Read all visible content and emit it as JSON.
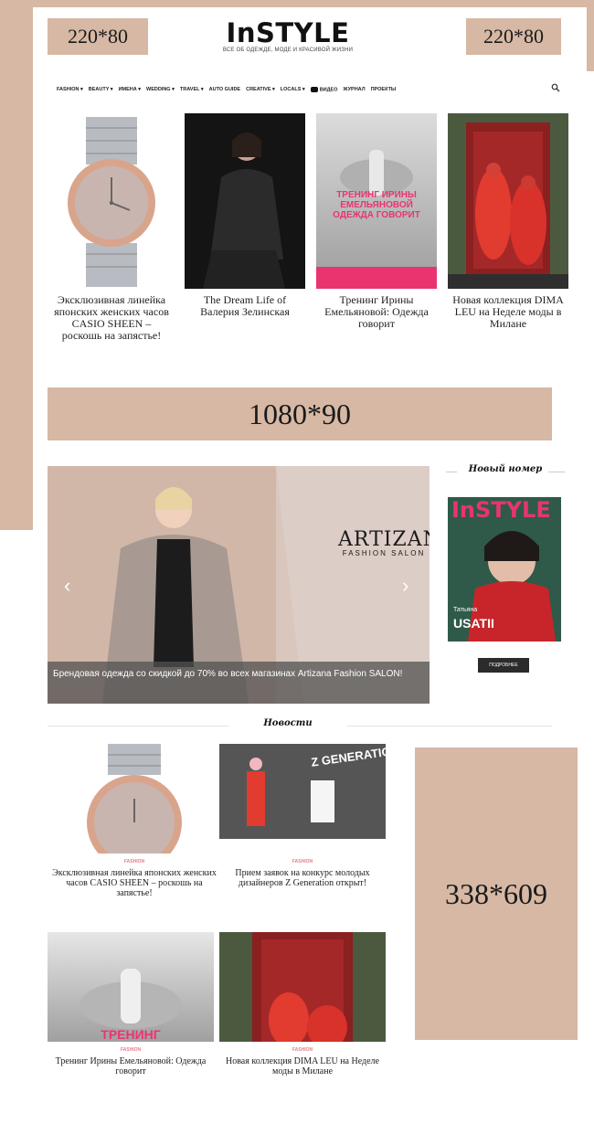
{
  "ads": {
    "left_header": "220*80",
    "right_header": "220*80",
    "middle_banner": "1080*90",
    "side": "338*609"
  },
  "logo": {
    "main": "InSTYLE",
    "tagline": "ВСЕ ОБ ОДЕЖДЕ, МОДЕ И КРАСИВОЙ ЖИЗНИ"
  },
  "nav": {
    "items": [
      "FASHION ▾",
      "BEAUTY ▾",
      "ИМЕНА ▾",
      "WEDDING ▾",
      "TRAVEL ▾",
      "AUTO GUIDE",
      "CREATIVE ▾",
      "LOCALS ▾",
      "ВИДЕО",
      "ЖУРНАЛ",
      "ПРОЕКТЫ"
    ]
  },
  "top_cards": [
    {
      "title": "Эксклюзивная линейка японских женских часов CASIO SHEEN – роскошь на запястье!"
    },
    {
      "title": "The Dream Life of Валерия Зелинская"
    },
    {
      "title": "Тренинг Ирины Емельяновой: Одежда говорит",
      "overlay": "ТРЕНИНГ ИРИНЫ ЕМЕЛЬЯНОВОЙ ОДЕЖДА ГОВОРИТ"
    },
    {
      "title": "Новая коллекция DIMA LEU на Неделе моды в Милане"
    }
  ],
  "slider": {
    "caption": "Брендовая одежда со скидкой до 70% во всех магазинах Artizana Fashion SALON!",
    "brand_name": "ARTIZANA",
    "brand_sub": "FASHION SALON"
  },
  "sidebar": {
    "title": "Новый номер",
    "magazine_logo": "InSTYLE",
    "magazine_name_small": "Татьяна",
    "magazine_name": "USATII",
    "button": "ПОДРОБНЕЕ"
  },
  "news": {
    "section_title": "Новости",
    "items": [
      {
        "category": "FASHION",
        "title": "Эксклюзивная линейка японских женских часов CASIO SHEEN – роскошь на запястье!"
      },
      {
        "category": "FASHION",
        "title": "Прием заявок на конкурс молодых дизайнеров Z Generation открыт!",
        "banner": "Z GENERATION"
      },
      {
        "category": "FASHION",
        "title": "Тренинг Ирины Емельяновой: Одежда говорит",
        "overlay": "ТРЕНИНГ"
      },
      {
        "category": "FASHION",
        "title": "Новая коллекция DIMA LEU на Неделе моды в Милане"
      }
    ]
  },
  "colors": {
    "ad_bg": "#d6b8a4",
    "accent_pink": "#e8356f",
    "category_pink": "#e57d8c"
  }
}
